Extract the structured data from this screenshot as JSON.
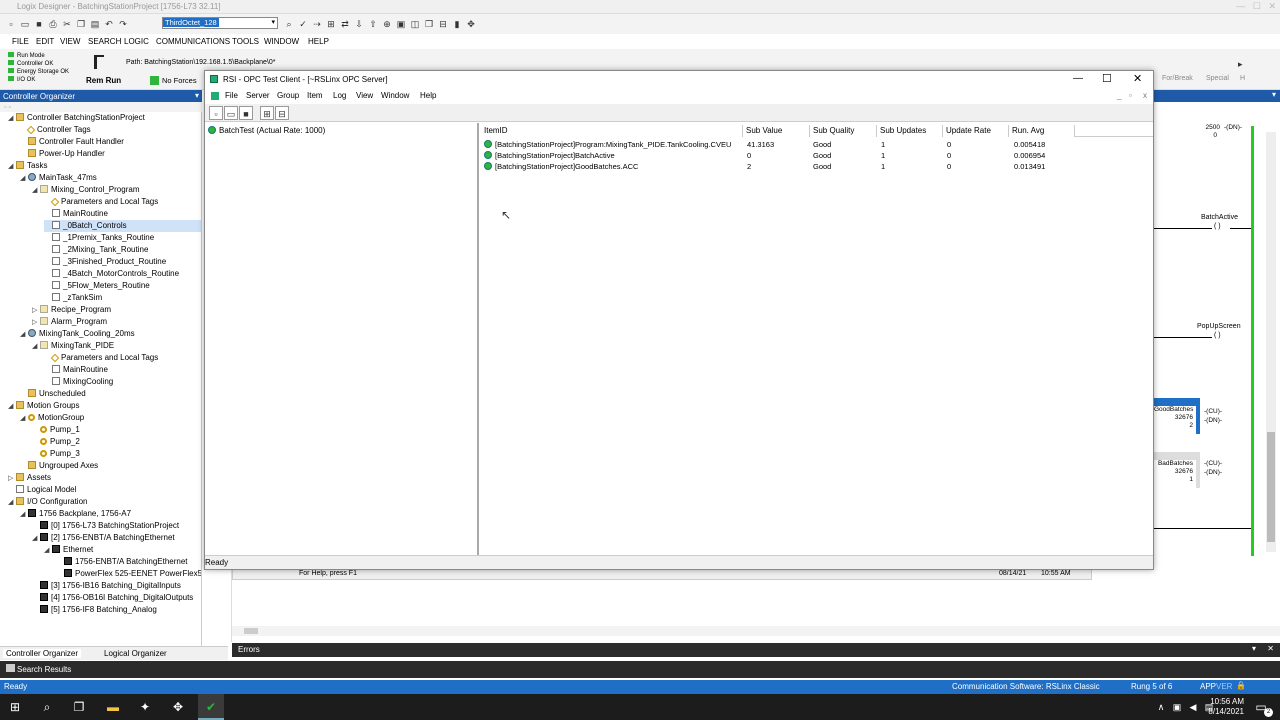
{
  "logix": {
    "window_title": "Logix Designer - BatchingStationProject [1756-L73 32.11]",
    "toolbar_combo": "ThirdOctet_128",
    "menus": [
      "FILE",
      "EDIT",
      "VIEW",
      "SEARCH",
      "LOGIC",
      "COMMUNICATIONS",
      "TOOLS",
      "WINDOW",
      "HELP"
    ],
    "status_lines": [
      "Run Mode",
      "Controller OK",
      "Energy Storage OK",
      "I/O OK"
    ],
    "run_mode": "Rem Run",
    "forces": "No Forces",
    "path": "Path: BatchingStation\\192.168.1.5\\Backplane\\0*",
    "right_tabs": [
      "For/Break",
      "Special",
      "H"
    ],
    "organizer_title": "Controller Organizer",
    "org_tabs": [
      "Controller Organizer",
      "Logical Organizer"
    ],
    "help_text": "For Help, press F1",
    "help_date": "08/14/21",
    "help_time": "10:55 AM",
    "errors_label": "Errors",
    "search_results": "Search Results",
    "status_ready": "Ready",
    "status_comm": "Communication Software: RSLinx Classic",
    "status_rung": "Rung 5 of 6",
    "status_app": "APP",
    "status_ver": "VER"
  },
  "tree": [
    {
      "label": "Controller BatchingStationProject",
      "indent": 1,
      "exp": "◢",
      "icon": "fld"
    },
    {
      "label": "Controller Tags",
      "indent": 2,
      "exp": "",
      "icon": "tag"
    },
    {
      "label": "Controller Fault Handler",
      "indent": 2,
      "exp": "",
      "icon": "fld"
    },
    {
      "label": "Power-Up Handler",
      "indent": 2,
      "exp": "",
      "icon": "fld"
    },
    {
      "label": "Tasks",
      "indent": 1,
      "exp": "◢",
      "icon": "fld"
    },
    {
      "label": "MainTask_47ms",
      "indent": 2,
      "exp": "◢",
      "icon": "clk"
    },
    {
      "label": "Mixing_Control_Program",
      "indent": 3,
      "exp": "◢",
      "icon": "rt"
    },
    {
      "label": "Parameters and Local Tags",
      "indent": 4,
      "exp": "",
      "icon": "tag"
    },
    {
      "label": "MainRoutine",
      "indent": 4,
      "exp": "",
      "icon": "doc"
    },
    {
      "label": "_0Batch_Controls",
      "indent": 4,
      "exp": "",
      "icon": "doc",
      "sel": true
    },
    {
      "label": "_1Premix_Tanks_Routine",
      "indent": 4,
      "exp": "",
      "icon": "doc"
    },
    {
      "label": "_2Mixing_Tank_Routine",
      "indent": 4,
      "exp": "",
      "icon": "doc"
    },
    {
      "label": "_3Finished_Product_Routine",
      "indent": 4,
      "exp": "",
      "icon": "doc"
    },
    {
      "label": "_4Batch_MotorControls_Routine",
      "indent": 4,
      "exp": "",
      "icon": "doc"
    },
    {
      "label": "_5Flow_Meters_Routine",
      "indent": 4,
      "exp": "",
      "icon": "doc"
    },
    {
      "label": "_zTankSim",
      "indent": 4,
      "exp": "",
      "icon": "doc"
    },
    {
      "label": "Recipe_Program",
      "indent": 3,
      "exp": "▷",
      "icon": "rt"
    },
    {
      "label": "Alarm_Program",
      "indent": 3,
      "exp": "▷",
      "icon": "rt"
    },
    {
      "label": "MixingTank_Cooling_20ms",
      "indent": 2,
      "exp": "◢",
      "icon": "clk"
    },
    {
      "label": "MixingTank_PIDE",
      "indent": 3,
      "exp": "◢",
      "icon": "rt"
    },
    {
      "label": "Parameters and Local Tags",
      "indent": 4,
      "exp": "",
      "icon": "tag"
    },
    {
      "label": "MainRoutine",
      "indent": 4,
      "exp": "",
      "icon": "doc"
    },
    {
      "label": "MixingCooling",
      "indent": 4,
      "exp": "",
      "icon": "doc"
    },
    {
      "label": "Unscheduled",
      "indent": 2,
      "exp": "",
      "icon": "fld"
    },
    {
      "label": "Motion Groups",
      "indent": 1,
      "exp": "◢",
      "icon": "fld"
    },
    {
      "label": "MotionGroup",
      "indent": 2,
      "exp": "◢",
      "icon": "ax"
    },
    {
      "label": "Pump_1",
      "indent": 3,
      "exp": "",
      "icon": "ax"
    },
    {
      "label": "Pump_2",
      "indent": 3,
      "exp": "",
      "icon": "ax"
    },
    {
      "label": "Pump_3",
      "indent": 3,
      "exp": "",
      "icon": "ax"
    },
    {
      "label": "Ungrouped Axes",
      "indent": 2,
      "exp": "",
      "icon": "fld"
    },
    {
      "label": "Assets",
      "indent": 1,
      "exp": "▷",
      "icon": "fld"
    },
    {
      "label": "Logical Model",
      "indent": 1,
      "exp": "",
      "icon": "doc"
    },
    {
      "label": "I/O Configuration",
      "indent": 1,
      "exp": "◢",
      "icon": "fld"
    },
    {
      "label": "1756 Backplane, 1756-A7",
      "indent": 2,
      "exp": "◢",
      "icon": "mod"
    },
    {
      "label": "[0] 1756-L73 BatchingStationProject",
      "indent": 3,
      "exp": "",
      "icon": "mod"
    },
    {
      "label": "[2] 1756-ENBT/A BatchingEthernet",
      "indent": 3,
      "exp": "◢",
      "icon": "mod"
    },
    {
      "label": "Ethernet",
      "indent": 4,
      "exp": "◢",
      "icon": "mod"
    },
    {
      "label": "1756-ENBT/A BatchingEthernet",
      "indent": 5,
      "exp": "",
      "icon": "mod"
    },
    {
      "label": "PowerFlex 525-EENET PowerFlex525",
      "indent": 5,
      "exp": "",
      "icon": "mod"
    },
    {
      "label": "[3] 1756-IB16 Batching_DigitalInputs",
      "indent": 3,
      "exp": "",
      "icon": "mod"
    },
    {
      "label": "[4] 1756-OB16I Batching_DigitalOutputs",
      "indent": 3,
      "exp": "",
      "icon": "mod"
    },
    {
      "label": "[5] 1756-IF8 Batching_Analog",
      "indent": 3,
      "exp": "",
      "icon": "mod"
    }
  ],
  "ladder": {
    "val_top": "2500",
    "val_top2": "0",
    "dn": "DN",
    "batch_active": "BatchActive",
    "popup_screen": "PopUpScreen",
    "good_batches": "GoodBatches",
    "good_pre": "32676",
    "good_acc": "2",
    "bad_batches": "BadBatches",
    "bad_pre": "32676",
    "bad_acc": "1",
    "cu": "CU"
  },
  "opc": {
    "title": "RSI - OPC Test Client - [~RSLinx OPC Server]",
    "menus": [
      "File",
      "Server",
      "Group",
      "Item",
      "Log",
      "View",
      "Window",
      "Help"
    ],
    "group": "BatchTest (Actual Rate: 1000)",
    "columns": [
      "ItemID",
      "Sub Value",
      "Sub Quality",
      "Sub Updates",
      "Update Rate",
      "Run. Avg"
    ],
    "rows": [
      {
        "id": "[BatchingStationProject]Program:MixingTank_PIDE.TankCooling.CVEU",
        "value": "41.3163",
        "quality": "Good",
        "updates": "1",
        "rate": "0",
        "avg": "0.005418"
      },
      {
        "id": "[BatchingStationProject]BatchActive",
        "value": "0",
        "quality": "Good",
        "updates": "1",
        "rate": "0",
        "avg": "0.006954"
      },
      {
        "id": "[BatchingStationProject]GoodBatches.ACC",
        "value": "2",
        "quality": "Good",
        "updates": "1",
        "rate": "0",
        "avg": "0.013491"
      }
    ],
    "status": "Ready"
  },
  "taskbar": {
    "time": "10:56 AM",
    "date": "8/14/2021",
    "notif_count": "2"
  }
}
